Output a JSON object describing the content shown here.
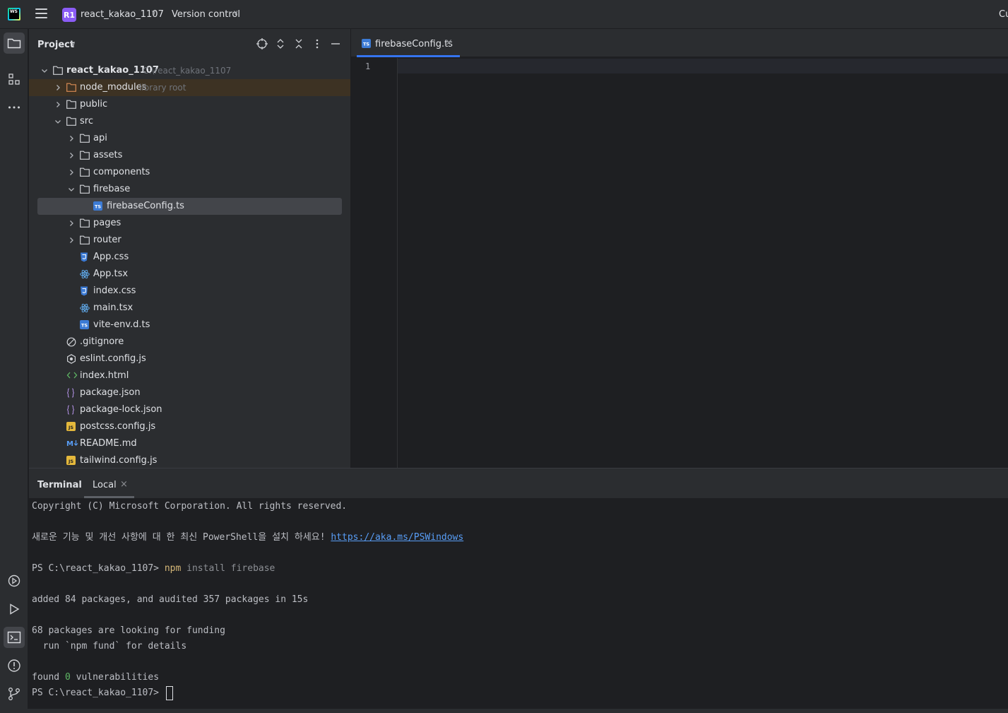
{
  "titlebar": {
    "logo_text": "WS",
    "menu_icon": "hamburger-icon",
    "project_badge": "R1",
    "project_name": "react_kakao_1107",
    "version_control": "Version control",
    "right_text": "Cu"
  },
  "toolstrip": {
    "top_items": [
      "folder-icon",
      "structure-icon",
      "more-icon"
    ],
    "bottom_items": [
      "services-icon",
      "run-icon",
      "terminal-icon",
      "problems-icon",
      "git-icon"
    ]
  },
  "project_panel": {
    "title": "Project",
    "header_icons": [
      "locate-icon",
      "expand-all-icon",
      "collapse-all-icon",
      "options-icon",
      "minimize-icon"
    ],
    "tree": [
      {
        "label": "react_kakao_1107",
        "hint": "C:\\react_kakao_1107",
        "type": "folder",
        "expanded": true
      },
      {
        "label": "node_modules",
        "hint": "library root",
        "type": "folder-lib",
        "expanded": false
      },
      {
        "label": "public",
        "type": "folder",
        "expanded": false
      },
      {
        "label": "src",
        "type": "folder",
        "expanded": true
      },
      {
        "label": "api",
        "type": "folder",
        "expanded": false
      },
      {
        "label": "assets",
        "type": "folder",
        "expanded": false
      },
      {
        "label": "components",
        "type": "folder",
        "expanded": false
      },
      {
        "label": "firebase",
        "type": "folder",
        "expanded": true
      },
      {
        "label": "firebaseConfig.ts",
        "type": "ts",
        "selected": true
      },
      {
        "label": "pages",
        "type": "folder",
        "expanded": false
      },
      {
        "label": "router",
        "type": "folder",
        "expanded": false
      },
      {
        "label": "App.css",
        "type": "css"
      },
      {
        "label": "App.tsx",
        "type": "react"
      },
      {
        "label": "index.css",
        "type": "css"
      },
      {
        "label": "main.tsx",
        "type": "react"
      },
      {
        "label": "vite-env.d.ts",
        "type": "ts"
      },
      {
        "label": ".gitignore",
        "type": "ignore"
      },
      {
        "label": "eslint.config.js",
        "type": "eslint"
      },
      {
        "label": "index.html",
        "type": "html"
      },
      {
        "label": "package.json",
        "type": "json"
      },
      {
        "label": "package-lock.json",
        "type": "json"
      },
      {
        "label": "postcss.config.js",
        "type": "js"
      },
      {
        "label": "README.md",
        "type": "md"
      },
      {
        "label": "tailwind.config.js",
        "type": "js"
      }
    ]
  },
  "editor": {
    "tab_label": "firebaseConfig.ts",
    "tab_close": "×",
    "line_number": "1"
  },
  "terminal": {
    "title": "Terminal",
    "tab_local": "Local",
    "tab_close": "×",
    "lines": {
      "copyright": "Copyright (C) Microsoft Corporation. All rights reserved.",
      "ps_notice": "새로운 기능 및 개선 사항에 대 한 최신 PowerShell을 설치 하세요! ",
      "ps_link": "https://aka.ms/PSWindows",
      "prompt1": "PS C:\\react_kakao_1107> ",
      "cmd_npm": "npm",
      "cmd_args": " install firebase",
      "added": "added 84 packages, and audited 357 packages in 15s",
      "funding": "68 packages are looking for funding",
      "fund_hint": "  run `npm fund` for details",
      "found_pre": "found ",
      "found_num": "0",
      "found_post": " vulnerabilities",
      "prompt2": "PS C:\\react_kakao_1107> "
    }
  },
  "colors": {
    "accent": "#3574f0",
    "background": "#1e1f22",
    "panel": "#2b2d30",
    "library_highlight": "#3d3223",
    "selection": "#43454a"
  }
}
